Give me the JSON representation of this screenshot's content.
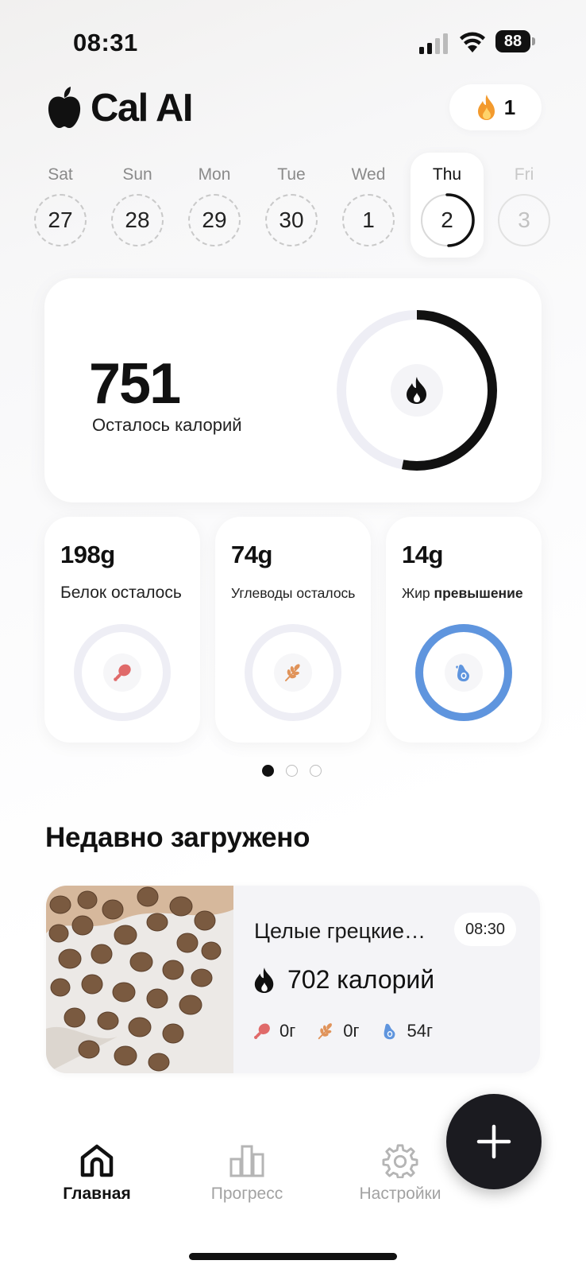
{
  "status_bar": {
    "time": "08:31",
    "battery": "88"
  },
  "header": {
    "app_title": "Cal AI",
    "streak_count": "1"
  },
  "days": [
    {
      "name": "Sat",
      "date": "27",
      "state": "past"
    },
    {
      "name": "Sun",
      "date": "28",
      "state": "past"
    },
    {
      "name": "Mon",
      "date": "29",
      "state": "past"
    },
    {
      "name": "Tue",
      "date": "30",
      "state": "past"
    },
    {
      "name": "Wed",
      "date": "1",
      "state": "past"
    },
    {
      "name": "Thu",
      "date": "2",
      "state": "active"
    },
    {
      "name": "Fri",
      "date": "3",
      "state": "future"
    }
  ],
  "calories": {
    "value": "751",
    "label": "Осталось калорий",
    "ring_progress": 0.53
  },
  "macros": [
    {
      "value": "198g",
      "label": "Белок осталось",
      "icon": "drumstick-icon",
      "color": "#e06a6a",
      "ring_progress": 0
    },
    {
      "value": "74g",
      "label": "Углеводы осталось",
      "icon": "wheat-icon",
      "color": "#e0935a",
      "ring_progress": 0
    },
    {
      "value": "14g",
      "label_prefix": "Жир ",
      "label_bold": "превышение",
      "icon": "avocado-icon",
      "color": "#5f95de",
      "ring_progress": 1
    }
  ],
  "pager": {
    "count": 3,
    "active": 0
  },
  "recent": {
    "title": "Недавно загружено",
    "items": [
      {
        "name": "Целые грецкие…",
        "time": "08:30",
        "calories": "702 калорий",
        "protein": "0г",
        "carbs": "0г",
        "fat": "54г"
      }
    ]
  },
  "nav": {
    "home": "Главная",
    "progress": "Прогресс",
    "settings": "Настройки"
  },
  "colors": {
    "accent": "#111111",
    "protein": "#e06a6a",
    "carbs": "#e0935a",
    "fat": "#5f95de",
    "ring_track": "#eeeef5"
  }
}
